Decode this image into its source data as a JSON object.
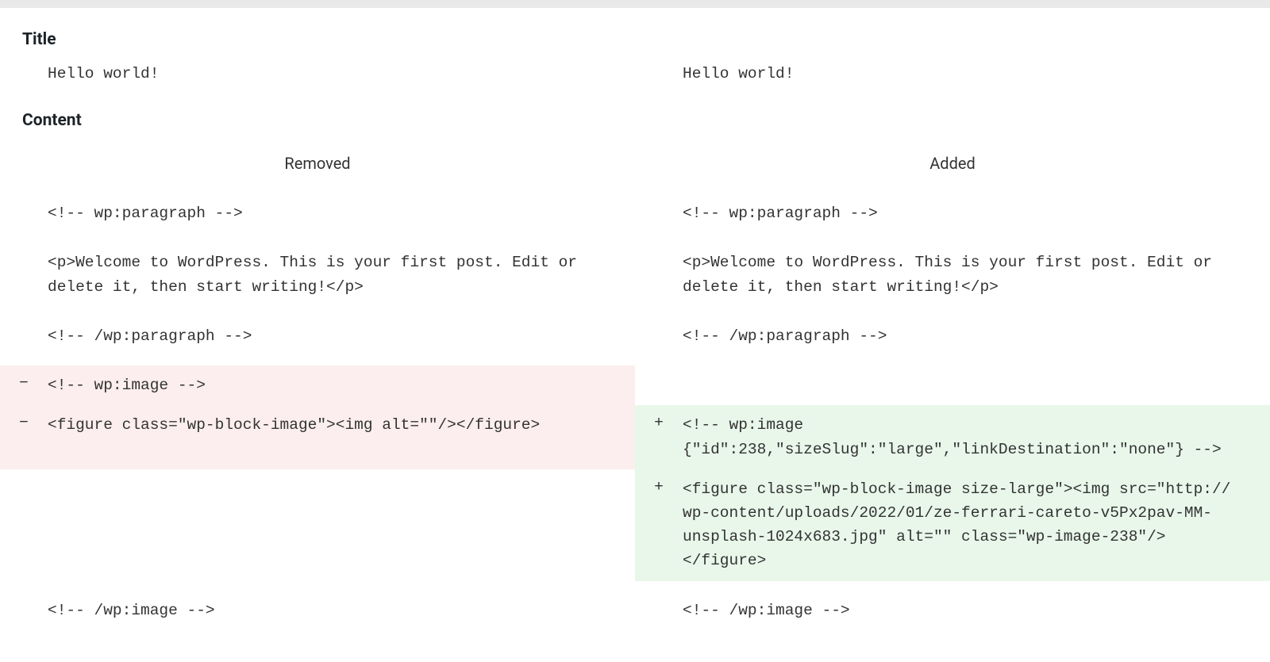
{
  "sections": {
    "title_label": "Title",
    "content_label": "Content",
    "removed_label": "Removed",
    "added_label": "Added"
  },
  "title_diff": {
    "left": "Hello world!",
    "right": "Hello world!"
  },
  "content_diff": [
    {
      "left": {
        "marker": "",
        "text": "<!-- wp:paragraph -->",
        "bg": ""
      },
      "right": {
        "marker": "",
        "text": "<!-- wp:paragraph -->",
        "bg": ""
      }
    },
    {
      "spacer": true
    },
    {
      "left": {
        "marker": "",
        "text": "<p>Welcome to WordPress. This is your first post. Edit or delete it, then start writing!</p>",
        "bg": ""
      },
      "right": {
        "marker": "",
        "text": "<p>Welcome to WordPress. This is your first post. Edit or delete it, then start writing!</p>",
        "bg": ""
      }
    },
    {
      "spacer": true
    },
    {
      "left": {
        "marker": "",
        "text": "<!-- /wp:paragraph -->",
        "bg": ""
      },
      "right": {
        "marker": "",
        "text": "<!-- /wp:paragraph -->",
        "bg": ""
      }
    },
    {
      "spacer": true
    },
    {
      "left": {
        "marker": "−",
        "text": "<!-- wp:image -->",
        "bg": "removed"
      },
      "right": {
        "marker": "",
        "text": "",
        "bg": ""
      }
    },
    {
      "left": {
        "marker": "−",
        "text": "<figure class=\"wp-block-image\"><img alt=\"\"/></figure>",
        "bg": "removed"
      },
      "right": {
        "marker": "+",
        "text": "<!-- wp:image {\"id\":238,\"sizeSlug\":\"large\",\"linkDestination\":\"none\"} -->",
        "bg": "added"
      }
    },
    {
      "left": {
        "marker": "",
        "text": "",
        "bg": ""
      },
      "right": {
        "marker": "+",
        "text": "<figure class=\"wp-block-image size-large\"><img src=\"http://              wp-content/uploads/2022/01/ze-ferrari-careto-v5Px2pav-MM-unsplash-1024x683.jpg\" alt=\"\" class=\"wp-image-238\"/></figure>",
        "bg": "added"
      }
    },
    {
      "spacer": true
    },
    {
      "left": {
        "marker": "",
        "text": "<!-- /wp:image -->",
        "bg": ""
      },
      "right": {
        "marker": "",
        "text": "<!-- /wp:image -->",
        "bg": ""
      }
    }
  ]
}
